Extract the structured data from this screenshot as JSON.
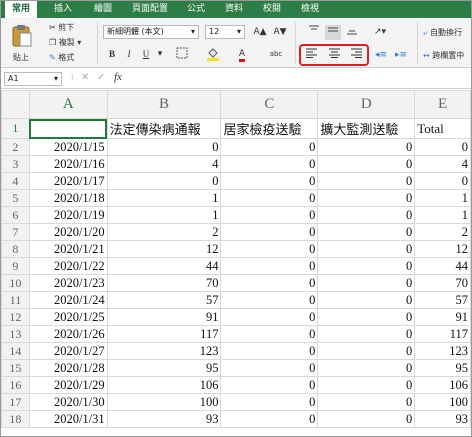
{
  "tabs": [
    "常用",
    "插入",
    "繪圖",
    "頁面配置",
    "公式",
    "資料",
    "校閱",
    "檢視"
  ],
  "ribbon": {
    "paste_label": "貼上",
    "cut_label": "剪下",
    "copy_label": "複製",
    "format_painter_label": "格式",
    "font_name": "新細明體 (本文)",
    "font_size": "12",
    "grow_font": "A▲",
    "shrink_font": "A▼",
    "bold": "B",
    "italic": "I",
    "underline": "U",
    "font_color_glyph": "A",
    "phonetic_glyph": "abc",
    "wrap_text_label": "自動換行",
    "merge_center_label": "跨欄置中"
  },
  "formula_bar": {
    "cell_ref": "A1",
    "cancel_glyph": "✕",
    "enter_glyph": "✓",
    "fx_glyph": "fx",
    "content": ""
  },
  "sheet": {
    "columns": [
      "A",
      "B",
      "C",
      "D",
      "E"
    ],
    "header_row": [
      "",
      "法定傳染病通報",
      "居家檢疫送驗",
      "擴大監測送驗",
      "Total"
    ],
    "rows": [
      {
        "n": "2",
        "date": "2020/1/15",
        "b": "0",
        "c": "0",
        "d": "0",
        "e": "0"
      },
      {
        "n": "3",
        "date": "2020/1/16",
        "b": "4",
        "c": "0",
        "d": "0",
        "e": "4"
      },
      {
        "n": "4",
        "date": "2020/1/17",
        "b": "0",
        "c": "0",
        "d": "0",
        "e": "0"
      },
      {
        "n": "5",
        "date": "2020/1/18",
        "b": "1",
        "c": "0",
        "d": "0",
        "e": "1"
      },
      {
        "n": "6",
        "date": "2020/1/19",
        "b": "1",
        "c": "0",
        "d": "0",
        "e": "1"
      },
      {
        "n": "7",
        "date": "2020/1/20",
        "b": "2",
        "c": "0",
        "d": "0",
        "e": "2"
      },
      {
        "n": "8",
        "date": "2020/1/21",
        "b": "12",
        "c": "0",
        "d": "0",
        "e": "12"
      },
      {
        "n": "9",
        "date": "2020/1/22",
        "b": "44",
        "c": "0",
        "d": "0",
        "e": "44"
      },
      {
        "n": "10",
        "date": "2020/1/23",
        "b": "70",
        "c": "0",
        "d": "0",
        "e": "70"
      },
      {
        "n": "11",
        "date": "2020/1/24",
        "b": "57",
        "c": "0",
        "d": "0",
        "e": "57"
      },
      {
        "n": "12",
        "date": "2020/1/25",
        "b": "91",
        "c": "0",
        "d": "0",
        "e": "91"
      },
      {
        "n": "13",
        "date": "2020/1/26",
        "b": "117",
        "c": "0",
        "d": "0",
        "e": "117"
      },
      {
        "n": "14",
        "date": "2020/1/27",
        "b": "123",
        "c": "0",
        "d": "0",
        "e": "123"
      },
      {
        "n": "15",
        "date": "2020/1/28",
        "b": "95",
        "c": "0",
        "d": "0",
        "e": "95"
      },
      {
        "n": "16",
        "date": "2020/1/29",
        "b": "106",
        "c": "0",
        "d": "0",
        "e": "106"
      },
      {
        "n": "17",
        "date": "2020/1/30",
        "b": "100",
        "c": "0",
        "d": "0",
        "e": "100"
      },
      {
        "n": "18",
        "date": "2020/1/31",
        "b": "93",
        "c": "0",
        "d": "0",
        "e": "93"
      }
    ]
  }
}
